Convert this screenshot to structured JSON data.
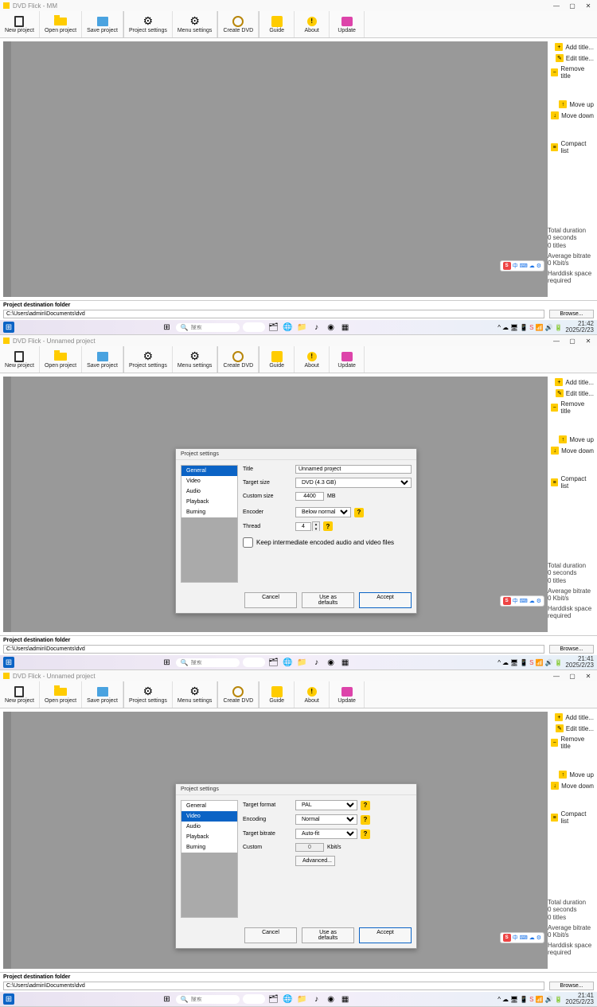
{
  "app1": {
    "title": "DVD Flick - MM"
  },
  "app2": {
    "title": "DVD Flick - Unnamed project"
  },
  "app3": {
    "title": "DVD Flick - Unnamed project"
  },
  "toolbar": [
    {
      "label": "New project",
      "icon": "new"
    },
    {
      "label": "Open project",
      "icon": "open"
    },
    {
      "label": "Save project",
      "icon": "save"
    },
    {
      "label": "Project settings",
      "icon": "gear"
    },
    {
      "label": "Menu settings",
      "icon": "gear"
    },
    {
      "label": "Create DVD",
      "icon": "disc"
    },
    {
      "label": "Guide",
      "icon": "guide"
    },
    {
      "label": "About",
      "icon": "about"
    },
    {
      "label": "Update",
      "icon": "update"
    }
  ],
  "side": [
    {
      "label": "Add title...",
      "icon": "+"
    },
    {
      "label": "Edit title...",
      "icon": "✎"
    },
    {
      "label": "Remove title",
      "icon": "−"
    }
  ],
  "side2": [
    {
      "label": "Move up",
      "icon": "↑"
    },
    {
      "label": "Move down",
      "icon": "↓"
    }
  ],
  "side3": [
    {
      "label": "Compact list",
      "icon": "≡"
    }
  ],
  "info": {
    "dur_lbl": "Total duration",
    "dur_val": "0 seconds",
    "titles_val": "0 titles",
    "br_lbl": "Average bitrate",
    "br_val": "0 Kbit/s",
    "hd_lbl": "Harddisk space required"
  },
  "footer": {
    "lbl": "Project destination folder",
    "path": "C:\\Users\\admin\\Documents\\dvd",
    "browse": "Browse..."
  },
  "taskbar": {
    "search_ph": "搜索",
    "time": "21:42",
    "date": "2025/2/23",
    "time2": "21:41",
    "time3": "21:41"
  },
  "dialog": {
    "title": "Project settings",
    "tabs": [
      "General",
      "Video",
      "Audio",
      "Playback",
      "Burning"
    ],
    "general": {
      "title_lbl": "Title",
      "title_val": "Unnamed project",
      "size_lbl": "Target size",
      "size_val": "DVD (4.3 GB)",
      "custom_lbl": "Custom size",
      "custom_val": "4400",
      "mb": "MB",
      "enc_lbl": "Encoder",
      "enc_val": "Below normal",
      "thread_lbl": "Thread",
      "thread_val": "4",
      "keep_lbl": "Keep intermediate encoded audio and video files"
    },
    "video": {
      "fmt_lbl": "Target format",
      "fmt_val": "PAL",
      "enc_lbl": "Encoding",
      "enc_val": "Normal",
      "br_lbl": "Target bitrate",
      "br_val": "Auto-fit",
      "custom_lbl": "Custom",
      "custom_val": "0",
      "kbits": "Kbit/s",
      "advanced": "Advanced..."
    },
    "btns": {
      "cancel": "Cancel",
      "defaults": "Use as defaults",
      "accept": "Accept"
    }
  },
  "tray_text": "中"
}
